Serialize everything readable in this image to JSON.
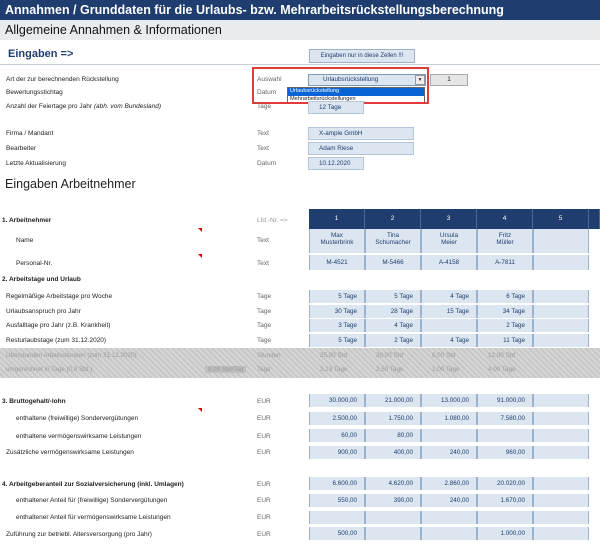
{
  "title": "Annahmen / Grunddaten für die Urlaubs- bzw. Mehrarbeitsrückstellungsberechnung",
  "section_allgemein": "Allgemeine Annahmen & Informationen",
  "eingaben": {
    "label": "Eingaben =>",
    "hint": "Eingaben nur in diese Zellen !!!"
  },
  "general_rows": [
    {
      "label": "Art der zur berechnenden Rückstellung",
      "unit": "Auswahl",
      "value": "Urlaubsrückstellung"
    },
    {
      "label": "Bewertungsstichtag",
      "unit": "Datum",
      "value": ""
    },
    {
      "label": "Anzahl der Feiertage pro Jahr",
      "label_note": "(abh. vom Bundesland)",
      "unit": "Tage",
      "value": "12 Tage"
    },
    {
      "label": "Firma / Mandant",
      "unit": "Text",
      "value": "X-ample GmbH"
    },
    {
      "label": "Bearbeiter",
      "unit": "Text",
      "value": "Adam Riese"
    },
    {
      "label": "Letzte Aktualisierung",
      "unit": "Datum",
      "value": "10.12.2020"
    }
  ],
  "dropdown": {
    "options": [
      "Urlaubsrückstellung",
      "Mehrarbeitsrückstellungen"
    ],
    "selected_index": 0,
    "pick_number": "1"
  },
  "section_arbeitnehmer": "Eingaben Arbeitnehmer",
  "table": {
    "lfd_label": "Lfd.-Nr. =>",
    "columns": [
      "1",
      "2",
      "3",
      "4",
      "5"
    ],
    "employee_label": "1. Arbeitnehmer",
    "name_label": "Name",
    "name_unit": "Text",
    "names": [
      [
        "Max",
        "Musterbrink"
      ],
      [
        "Tina",
        "Schumacher"
      ],
      [
        "Ursula",
        "Meier"
      ],
      [
        "Fritz",
        "Müller"
      ],
      [
        "",
        ""
      ]
    ],
    "personal_label": "Personal-Nr.",
    "personal_unit": "Text",
    "personal_nrs": [
      "M-4521",
      "M-5466",
      "A-4158",
      "A-7811",
      ""
    ],
    "section2": "2. Arbeitstage und Urlaub",
    "rows2": [
      {
        "label": "Regelmäßige Arbeitstage pro Woche",
        "unit": "Tage",
        "values": [
          "5 Tage",
          "5 Tage",
          "4 Tage",
          "6 Tage",
          ""
        ]
      },
      {
        "label": "Urlaubsanspruch pro Jahr",
        "unit": "Tage",
        "values": [
          "30 Tage",
          "28 Tage",
          "15 Tage",
          "34 Tage",
          ""
        ]
      },
      {
        "label": "Ausfalltage pro Jahr (z.B. Krankheit)",
        "unit": "Tage",
        "values": [
          "3 Tage",
          "4 Tage",
          "",
          "2 Tage",
          ""
        ]
      },
      {
        "label": "Resturlaubstage (zum 31.12.2020)",
        "unit": "Tage",
        "values": [
          "5 Tage",
          "2 Tage",
          "4 Tage",
          "11 Tage",
          ""
        ]
      }
    ],
    "hatch_rows": [
      {
        "label": "Überstunden Arbeitsstunden (zum 31.12.2020)",
        "unit": "Stunden",
        "values": [
          "25,00 Std",
          "20,00 Std",
          "6,00 Std",
          "12,00 Std",
          ""
        ]
      },
      {
        "label": "umgerechnet in Tage (0,8 Std.)",
        "unit": "Tage",
        "extra": "8,00 Std/Tag",
        "values": [
          "3,13 Tage",
          "2,50 Tage",
          "1,00 Tage",
          "4,00 Tage",
          ""
        ]
      }
    ],
    "section3": "3. Bruttogehalt/-lohn",
    "section3_unit": "EUR",
    "section3_values": [
      "30.000,00",
      "21.000,00",
      "13.000,00",
      "91.000,00",
      ""
    ],
    "rows3": [
      {
        "label": "enthaltene (freiwillige) Sondervergütungen",
        "unit": "EUR",
        "values": [
          "2.500,00",
          "1.750,00",
          "1.080,00",
          "7.580,00",
          ""
        ]
      },
      {
        "label": "enthaltene vermögenswirksame Leistungen",
        "unit": "EUR",
        "values": [
          "60,00",
          "80,00",
          "",
          "",
          ""
        ]
      },
      {
        "label": "Zusätzliche vermögenswirksame Leistungen",
        "unit": "EUR",
        "values": [
          "900,00",
          "400,00",
          "240,00",
          "960,00",
          ""
        ]
      }
    ],
    "section4": "4. Arbeitgeberanteil zur Sozialversicherung (inkl. Umlagen)",
    "section4_unit": "EUR",
    "section4_values": [
      "6.600,00",
      "4.620,00",
      "2.860,00",
      "20.020,00",
      ""
    ],
    "rows4": [
      {
        "label": "enthaltener Anteil für (freiwillige) Sondervergütungen",
        "unit": "EUR",
        "values": [
          "550,00",
          "390,00",
          "240,00",
          "1.670,00",
          ""
        ]
      },
      {
        "label": "enthaltener Anteil für vermögenswirksame Leistungen",
        "unit": "EUR",
        "values": [
          "",
          "",
          "",
          "",
          ""
        ]
      },
      {
        "label": "Zuführung zur betriebl. Altersversorgung (pro Jahr)",
        "unit": "EUR",
        "values": [
          "500,00",
          "",
          "",
          "1.000,00",
          ""
        ]
      }
    ]
  }
}
